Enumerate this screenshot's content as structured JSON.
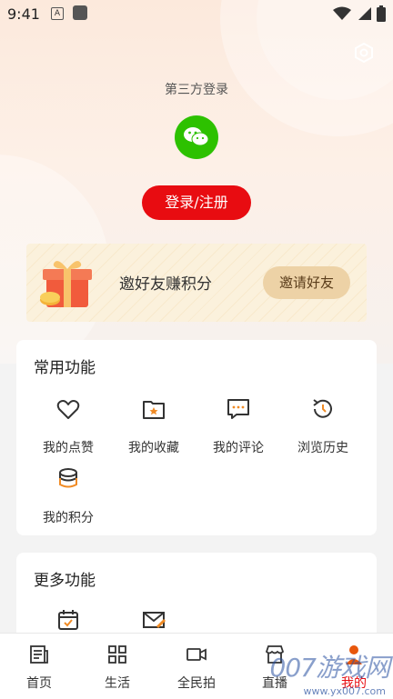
{
  "status_bar": {
    "time": "9:41",
    "badge": "A"
  },
  "login": {
    "third_party_label": "第三方登录",
    "login_button": "登录/注册"
  },
  "invite": {
    "text": "邀好友赚积分",
    "button": "邀请好友"
  },
  "common": {
    "title": "常用功能",
    "items": [
      {
        "label": "我的点赞",
        "icon": "heart-icon"
      },
      {
        "label": "我的收藏",
        "icon": "folder-star-icon"
      },
      {
        "label": "我的评论",
        "icon": "comment-icon"
      },
      {
        "label": "浏览历史",
        "icon": "history-icon"
      },
      {
        "label": "我的积分",
        "icon": "coins-icon"
      }
    ]
  },
  "more": {
    "title": "更多功能",
    "items": [
      {
        "icon": "calendar-check-icon"
      },
      {
        "icon": "mail-edit-icon"
      }
    ]
  },
  "tabbar": {
    "items": [
      {
        "label": "首页",
        "icon": "news-icon"
      },
      {
        "label": "生活",
        "icon": "grid-icon"
      },
      {
        "label": "全民拍",
        "icon": "video-icon"
      },
      {
        "label": "直播",
        "icon": "store-icon"
      },
      {
        "label": "我的",
        "icon": "user-icon"
      }
    ],
    "active_index": 4
  },
  "watermark": {
    "text": "007游戏网",
    "sub": "www.yx007.com"
  },
  "colors": {
    "accent": "#e80c11",
    "wechat": "#2dc100",
    "invite_button": "#edd2a6"
  }
}
